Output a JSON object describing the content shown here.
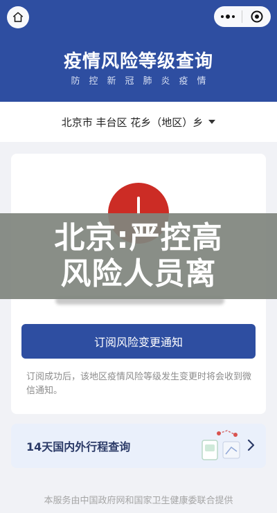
{
  "header": {
    "title": "疫情风险等级查询",
    "subtitle": "防控新冠肺炎疫情"
  },
  "region": {
    "text": "北京市 丰台区 花乡（地区）乡"
  },
  "card": {
    "subscribe_label": "订阅风险变更通知",
    "tip": "订阅成功后，该地区疫情风险等级发生变更时将会收到微信通知。"
  },
  "overlay": {
    "text": "北京:严控高风险人员离"
  },
  "trip": {
    "label": "14天国内外行程查询"
  },
  "footer": {
    "text": "本服务由中国政府网和国家卫生健康委联合提供"
  },
  "colors": {
    "brand": "#2e4ea1",
    "risk_high": "#cc2c25",
    "overlay": "#80857e"
  },
  "icons": [
    "home-icon",
    "more-icon",
    "target-icon",
    "dropdown-caret-icon",
    "chevron-right-icon"
  ]
}
